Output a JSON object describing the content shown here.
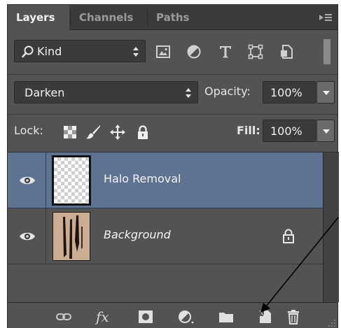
{
  "tabs": [
    {
      "label": "Layers",
      "active": true
    },
    {
      "label": "Channels",
      "active": false
    },
    {
      "label": "Paths",
      "active": false
    }
  ],
  "filter": {
    "kind_label": "Kind",
    "icons": [
      "pixel-layer-filter-icon",
      "adjustment-layer-filter-icon",
      "type-layer-filter-icon",
      "shape-layer-filter-icon",
      "smart-object-filter-icon"
    ]
  },
  "blend": {
    "mode": "Darken",
    "opacity_label": "Opacity:",
    "opacity_value": "100%"
  },
  "lock": {
    "label": "Lock:",
    "icons": [
      "lock-transparent-pixels-icon",
      "lock-image-pixels-icon",
      "lock-position-icon",
      "lock-all-icon"
    ],
    "fill_label": "Fill:",
    "fill_value": "100%"
  },
  "layers": [
    {
      "name": "Halo Removal",
      "selected": true,
      "visible": true,
      "locked": false
    },
    {
      "name": "Background",
      "selected": false,
      "visible": true,
      "locked": true
    }
  ],
  "bottom_icons": [
    "link-layers-icon",
    "layer-style-fx-icon",
    "add-mask-icon",
    "new-adjustment-layer-icon",
    "new-group-folder-icon",
    "new-layer-icon",
    "delete-layer-trash-icon"
  ],
  "bottom_fx_label": "fx",
  "colors": {
    "panel": "#535353",
    "tabbar": "#3b3b3b",
    "selected_layer": "#5d7391",
    "field": "#3b3b3b",
    "text": "#e6e6e6"
  }
}
